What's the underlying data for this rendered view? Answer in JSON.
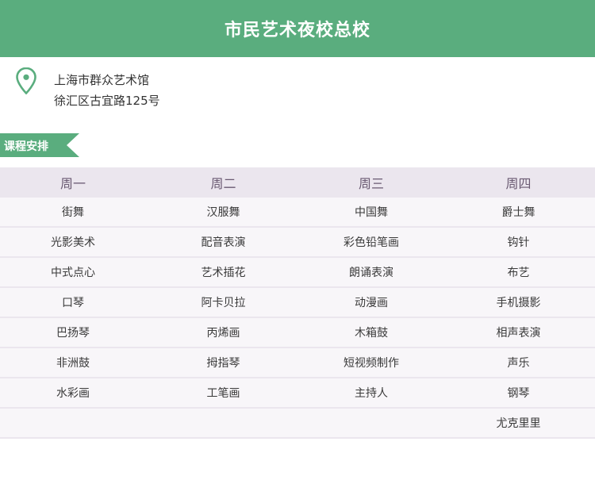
{
  "header": {
    "title": "市民艺术夜校总校"
  },
  "location": {
    "icon": "location-pin-icon",
    "icon_color": "#5aad7e",
    "name": "上海市群众艺术馆",
    "address": "徐汇区古宜路125号"
  },
  "section": {
    "label": "课程安排",
    "color": "#5aad7e"
  },
  "schedule": {
    "days": [
      "周一",
      "周二",
      "周三",
      "周四"
    ],
    "rows": [
      [
        "街舞",
        "汉服舞",
        "中国舞",
        "爵士舞"
      ],
      [
        "光影美术",
        "配音表演",
        "彩色铅笔画",
        "钩针"
      ],
      [
        "中式点心",
        "艺术插花",
        "朗诵表演",
        "布艺"
      ],
      [
        "口琴",
        "阿卡贝拉",
        "动漫画",
        "手机摄影"
      ],
      [
        "巴扬琴",
        "丙烯画",
        "木箱鼓",
        "相声表演"
      ],
      [
        "非洲鼓",
        "拇指琴",
        "短视频制作",
        "声乐"
      ],
      [
        "水彩画",
        "工笔画",
        "主持人",
        "钢琴"
      ],
      [
        "",
        "",
        "",
        "尤克里里"
      ]
    ]
  }
}
